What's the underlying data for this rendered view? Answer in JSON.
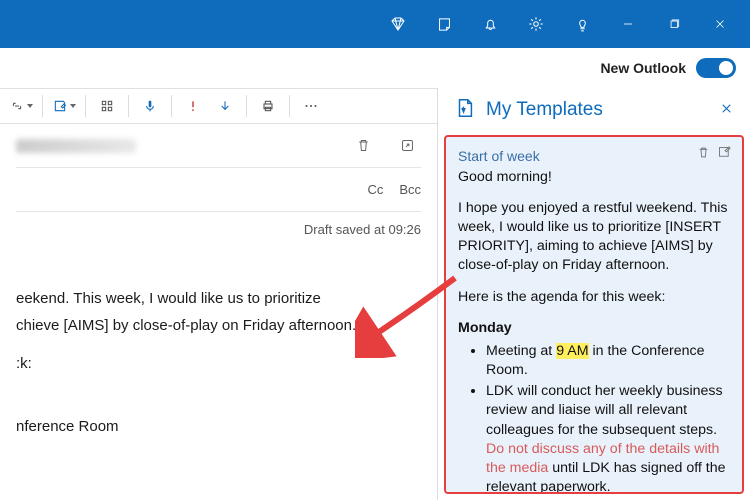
{
  "subbar": {
    "new_outlook_label": "New Outlook"
  },
  "compose": {
    "cc": "Cc",
    "bcc": "Bcc",
    "draft_status": "Draft saved at 09:26",
    "body_p1": "eekend. This week, I would like us to prioritize",
    "body_p2": "chieve [AIMS] by close-of-play on Friday afternoon.",
    "body_p3": ":k:",
    "body_p4": "nference Room"
  },
  "panel": {
    "title": "My Templates",
    "template": {
      "name": "Start of week",
      "greeting": "Good morning!",
      "intro": "I hope you enjoyed a restful weekend. This week, I would like us to prioritize [INSERT PRIORITY], aiming to achieve [AIMS] by close-of-play on Friday afternoon.",
      "agenda_intro": "Here is the agenda for this week:",
      "day": "Monday",
      "li1_a": "Meeting at ",
      "li1_hl": "9 AM",
      "li1_b": " in the Conference Room.",
      "li2_a": "LDK will conduct her weekly business review and liaise will all relevant colleagues for the subsequent steps. ",
      "li2_warn": "Do not discuss any of the details with the media",
      "li2_b": " until LDK has signed off the relevant paperwork."
    }
  }
}
